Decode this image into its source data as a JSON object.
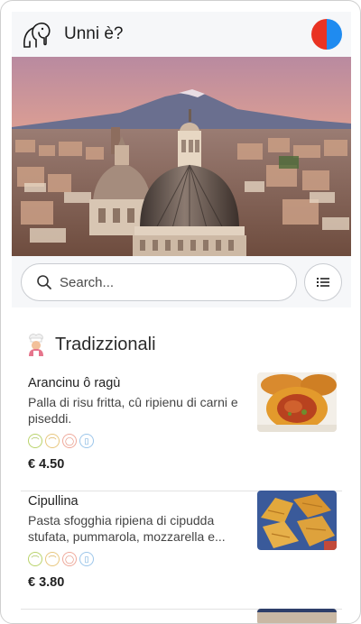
{
  "header": {
    "title": "Unni è?",
    "logo_icon": "elephant-logo-icon",
    "lang_colors": [
      "#e93323",
      "#1f8bf0"
    ]
  },
  "search": {
    "placeholder": "Search...",
    "icon": "search-icon",
    "filter_icon": "list-icon"
  },
  "section": {
    "title": "Tradizzionali",
    "icon": "chef-icon"
  },
  "items": [
    {
      "name": "Arancinu ô ragù",
      "description": "Palla di risu fritta, cû ripienu di carni e piseddi.",
      "price": "€ 4.50",
      "allergens": [
        "gluten-icon",
        "egg-icon",
        "nut-icon",
        "milk-icon"
      ]
    },
    {
      "name": "Cipullina",
      "description": "Pasta sfogghia ripiena di cipudda stufata, pummarola, mozzarella e...",
      "price": "€ 3.80",
      "allergens": [
        "gluten-icon",
        "egg-icon",
        "nut-icon",
        "milk-icon"
      ]
    }
  ]
}
